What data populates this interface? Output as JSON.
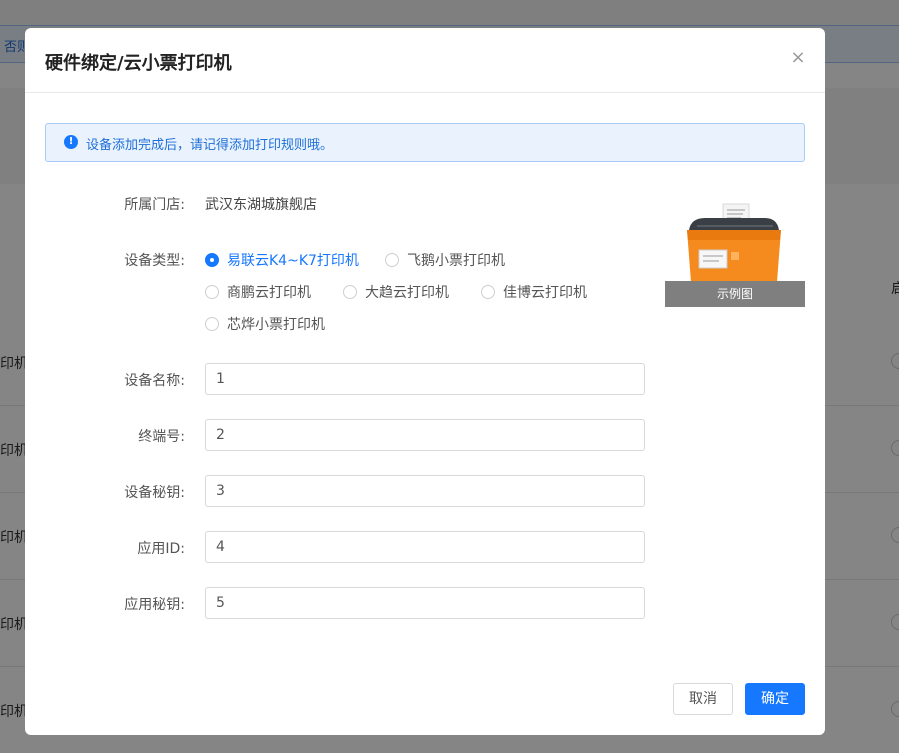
{
  "background": {
    "alert_text": "否则",
    "header_right_text": "启",
    "row_label": "印机"
  },
  "dialog": {
    "title": "硬件绑定/云小票打印机",
    "close_symbol": "×",
    "notice": "设备添加完成后，请记得添加打印规则哦。",
    "store": {
      "label": "所属门店:",
      "value": "武汉东湖城旗舰店"
    },
    "device_type": {
      "label": "设备类型:",
      "options": [
        "易联云K4~K7打印机",
        "飞鹅小票打印机",
        "商鹏云打印机",
        "大趋云打印机",
        "佳博云打印机",
        "芯烨小票打印机"
      ],
      "selected": "易联云K4~K7打印机"
    },
    "fields": {
      "device_name": {
        "label": "设备名称:",
        "value": "1"
      },
      "terminal_no": {
        "label": "终端号:",
        "value": "2"
      },
      "device_key": {
        "label": "设备秘钥:",
        "value": "3"
      },
      "app_id": {
        "label": "应用ID:",
        "value": "4"
      },
      "app_key": {
        "label": "应用秘钥:",
        "value": "5"
      }
    },
    "example_caption": "示例图",
    "buttons": {
      "cancel": "取消",
      "ok": "确定"
    }
  },
  "colors": {
    "primary": "#1677ff",
    "notice_bg": "#eaf3fd",
    "printer_orange": "#f58a1f"
  }
}
